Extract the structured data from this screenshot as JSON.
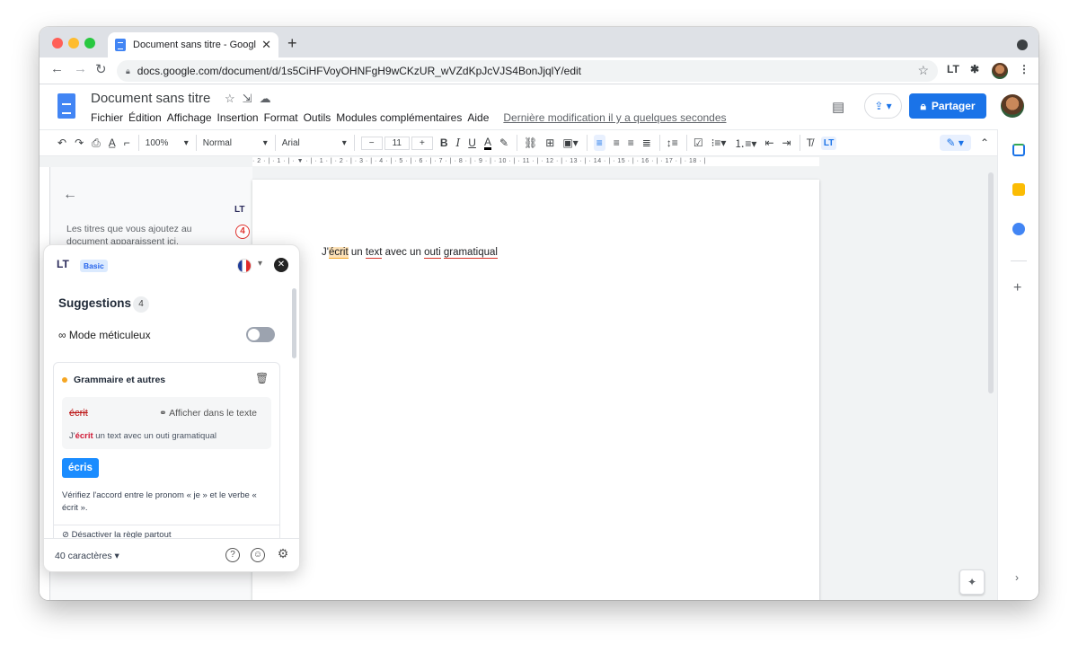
{
  "browser": {
    "tab_title": "Document sans titre - Google D",
    "tab_close": "✕",
    "new_tab": "+",
    "url": "docs.google.com/document/d/1s5CiHFVoyOHNFgH9wCKzUR_wVZdKpJcVJS4BonJjqlY/edit",
    "traffic_colors": [
      "#ff5f57",
      "#febc2e",
      "#28c840"
    ]
  },
  "docs": {
    "title": "Document sans titre",
    "menu": [
      "Fichier",
      "Édition",
      "Affichage",
      "Insertion",
      "Format",
      "Outils",
      "Modules complémentaires",
      "Aide"
    ],
    "last_modified": "Dernière modification il y a quelques secondes",
    "share_label": "Partager",
    "zoom": "100%",
    "style": "Normal",
    "font": "Arial",
    "font_size": "11",
    "ruler": "· 2 · | · 1 · | · ▼ · | · 1 · | · 2 · | · 3 · | · 4 · | · 5 · | · 6 · | · 7 · | · 8 · | · 9 · | · 10 · | · 11 · | · 12 · | · 13 · | · 14 · | · 15 · | · 16 · | · 17 · | · 18 · |",
    "outline_hint": "Les titres que vous ajoutez au document apparaissent ici."
  },
  "document": {
    "pre": "J'",
    "w1": "écrit",
    "m1": " un ",
    "w2": "text",
    "m2": " avec un ",
    "w3": "outi",
    "m3": " ",
    "w4": "gramatiqual"
  },
  "languagetool": {
    "logo": "LT",
    "plan": "Basic",
    "badge_count": "4",
    "suggestions_title": "Suggestions",
    "suggestions_count": "4",
    "mode_label": "Mode méticuleux",
    "card_title": "Grammaire et autres",
    "error_word": "écrit",
    "show_in_text": "Afficher dans le texte",
    "context_pre": "J'",
    "context_word": "écrit",
    "context_post": " un text avec un outi gramatiqual",
    "replacement": "écris",
    "message": "Vérifiez l'accord entre le pronom « je » et le verbe « écrit ».",
    "disable_rule": "Désactiver la règle partout",
    "char_count": "40 caractères",
    "help_icon": "?",
    "feedback_icon": "☺",
    "settings_icon": "⚙"
  },
  "colors": {
    "share_blue": "#1a73e8",
    "lt_blue": "#1a8cff",
    "error_orange": "#f5a623",
    "error_red": "#d93025"
  }
}
